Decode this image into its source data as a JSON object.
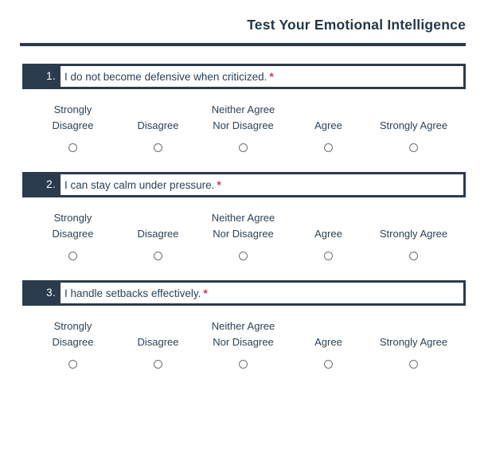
{
  "header": {
    "title": "Test Your Emotional Intelligence"
  },
  "colors": {
    "navy": "#2b3b4d",
    "title_text": "#25384a",
    "question_text": "#2c4257",
    "required_star": "#cf3a57",
    "radio_border": "#6f6f6f",
    "page_background": "#ffffff"
  },
  "scale": {
    "options": [
      {
        "label": "Strongly Disagree",
        "value": "strongly-disagree"
      },
      {
        "label": "Disagree",
        "value": "disagree"
      },
      {
        "label": "Neither Agree Nor Disagree",
        "value": "neither-agree-nor-disagree"
      },
      {
        "label": "Agree",
        "value": "agree"
      },
      {
        "label": "Strongly Agree",
        "value": "strongly-agree"
      }
    ]
  },
  "questions": [
    {
      "number": "1.",
      "text": "I do not become defensive when criticized.",
      "required_marker": "*",
      "selected": null
    },
    {
      "number": "2.",
      "text": "I can stay calm under pressure.",
      "required_marker": "*",
      "selected": null
    },
    {
      "number": "3.",
      "text": "I handle setbacks effectively.",
      "required_marker": "*",
      "selected": null
    }
  ]
}
